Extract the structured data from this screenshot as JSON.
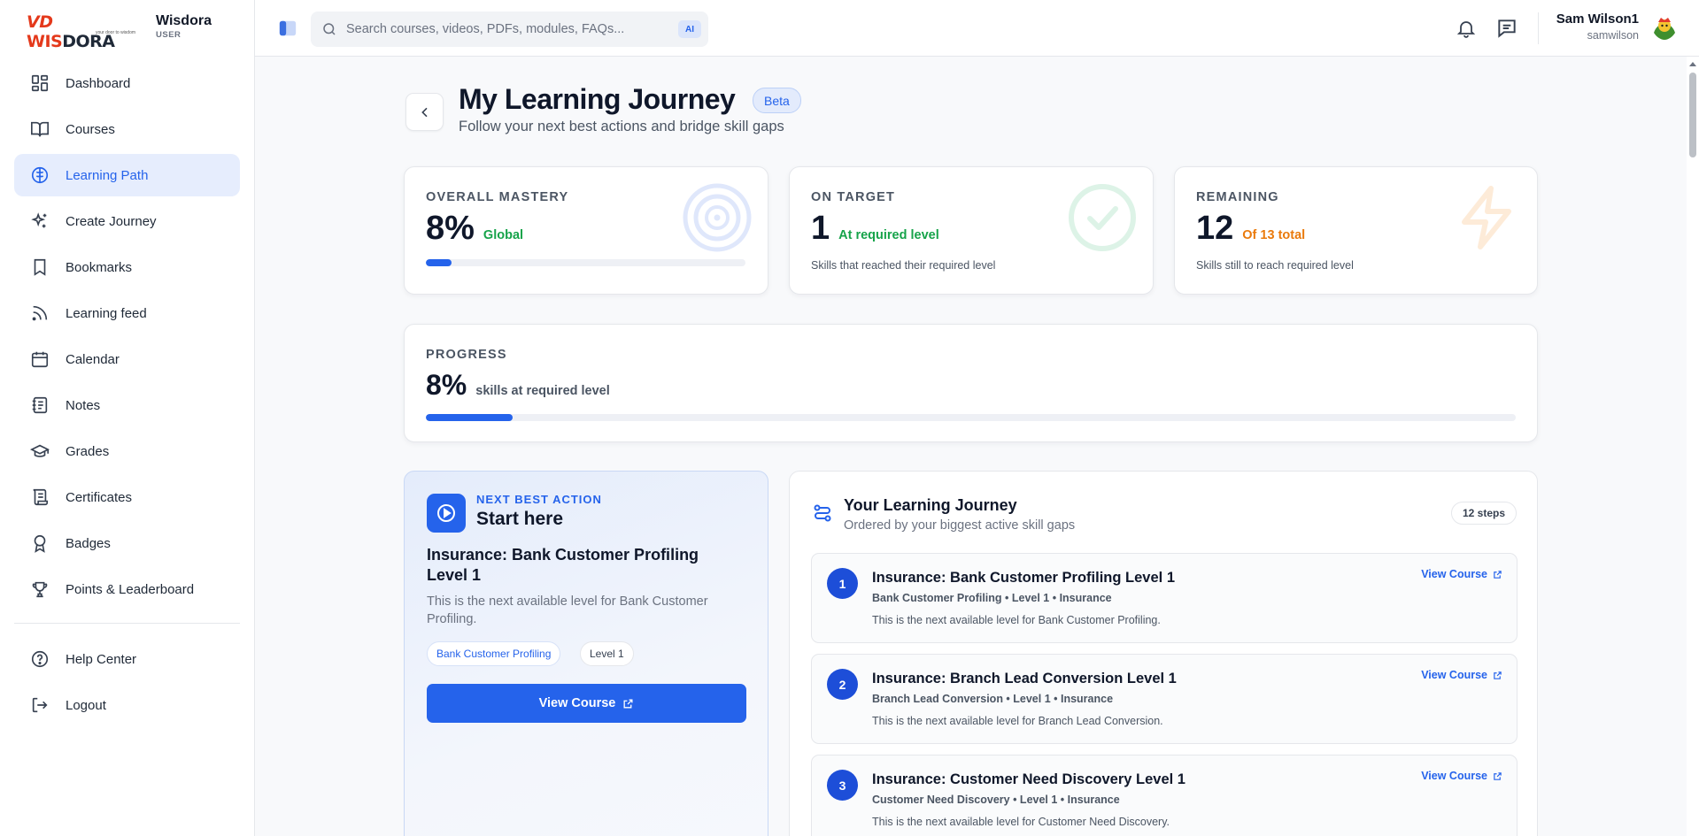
{
  "brand": {
    "logo_text_1": "VD",
    "logo_text_2": "WIS",
    "logo_text_3": "DORA",
    "tagline": "your door to wisdom",
    "name": "Wisdora",
    "role": "USER"
  },
  "sidebar": {
    "items": [
      {
        "label": "Dashboard",
        "icon": "dashboard-icon",
        "active": false
      },
      {
        "label": "Courses",
        "icon": "book-open-icon",
        "active": false
      },
      {
        "label": "Learning Path",
        "icon": "brain-icon",
        "active": true
      },
      {
        "label": "Create Journey",
        "icon": "sparkles-icon",
        "active": false
      },
      {
        "label": "Bookmarks",
        "icon": "bookmark-icon",
        "active": false
      },
      {
        "label": "Learning feed",
        "icon": "rss-icon",
        "active": false
      },
      {
        "label": "Calendar",
        "icon": "calendar-icon",
        "active": false
      },
      {
        "label": "Notes",
        "icon": "notebook-icon",
        "active": false
      },
      {
        "label": "Grades",
        "icon": "graduation-cap-icon",
        "active": false
      },
      {
        "label": "Certificates",
        "icon": "scroll-icon",
        "active": false
      },
      {
        "label": "Badges",
        "icon": "award-icon",
        "active": false
      },
      {
        "label": "Points & Leaderboard",
        "icon": "trophy-icon",
        "active": false
      }
    ],
    "bottom_items": [
      {
        "label": "Help Center",
        "icon": "help-circle-icon"
      },
      {
        "label": "Logout",
        "icon": "logout-icon"
      }
    ]
  },
  "topbar": {
    "search_placeholder": "Search courses, videos, PDFs, modules, FAQs...",
    "search_value": "",
    "ai_label": "AI",
    "user_name": "Sam Wilson1",
    "user_handle": "samwilson"
  },
  "page": {
    "title": "My Learning Journey",
    "badge": "Beta",
    "subtitle": "Follow your next best actions and bridge skill gaps"
  },
  "stats": {
    "mastery": {
      "label": "OVERALL MASTERY",
      "value": "8%",
      "note": "Global",
      "progress": 0.08
    },
    "on_target": {
      "label": "ON TARGET",
      "value": "1",
      "note": "At required level",
      "desc": "Skills that reached their required level"
    },
    "remaining": {
      "label": "REMAINING",
      "value": "12",
      "note": "Of 13 total",
      "desc": "Skills still to reach required level"
    }
  },
  "progress": {
    "label": "PROGRESS",
    "value": "8%",
    "note": "skills at required level",
    "fraction": 0.08
  },
  "next_action": {
    "kicker": "NEXT BEST ACTION",
    "heading": "Start here",
    "title": "Insurance: Bank Customer Profiling Level 1",
    "desc": "This is the next available level for Bank Customer Profiling.",
    "chip_skill": "Bank Customer Profiling",
    "chip_level": "Level 1",
    "button": "View Course"
  },
  "journey": {
    "title": "Your Learning Journey",
    "subtitle": "Ordered by your biggest active skill gaps",
    "steps_badge": "12 steps",
    "link_label": "View Course",
    "steps": [
      {
        "num": "1",
        "title": "Insurance: Bank Customer Profiling Level 1",
        "meta": "Bank Customer Profiling • Level 1 • Insurance",
        "desc": "This is the next available level for Bank Customer Profiling."
      },
      {
        "num": "2",
        "title": "Insurance: Branch Lead Conversion Level 1",
        "meta": "Branch Lead Conversion • Level 1 • Insurance",
        "desc": "This is the next available level for Branch Lead Conversion."
      },
      {
        "num": "3",
        "title": "Insurance: Customer Need Discovery Level 1",
        "meta": "Customer Need Discovery • Level 1 • Insurance",
        "desc": "This is the next available level for Customer Need Discovery."
      }
    ]
  },
  "colors": {
    "accent": "#2563eb",
    "success": "#16a34a",
    "warning": "#ea7a0c"
  }
}
